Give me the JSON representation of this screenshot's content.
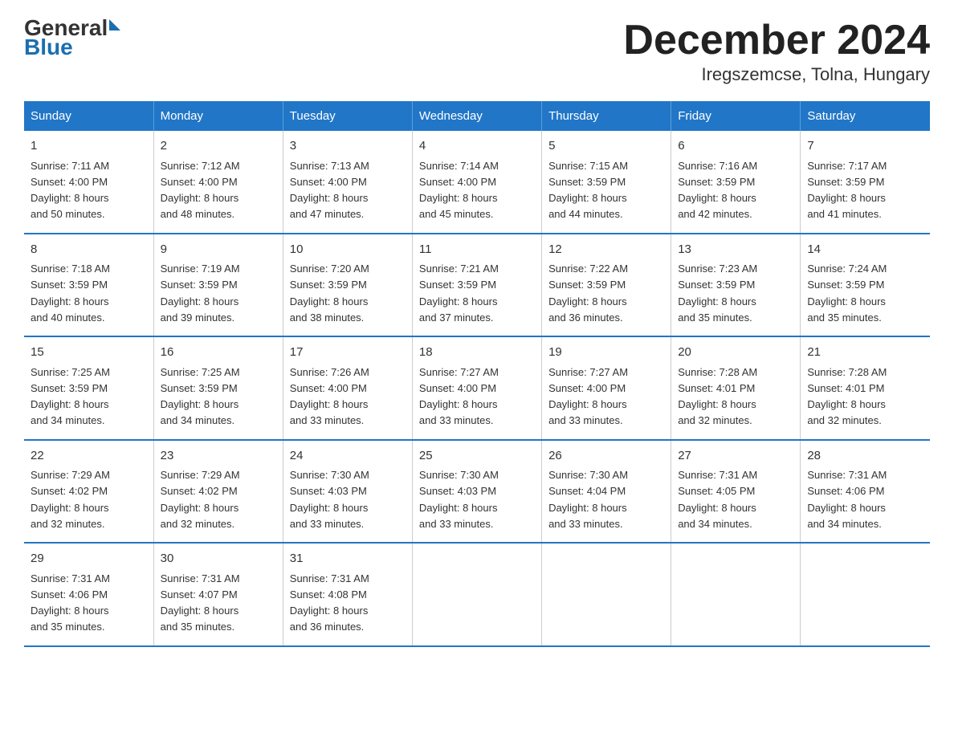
{
  "logo": {
    "text_general": "General",
    "text_blue": "Blue"
  },
  "title": "December 2024",
  "subtitle": "Iregszemcse, Tolna, Hungary",
  "days_of_week": [
    "Sunday",
    "Monday",
    "Tuesday",
    "Wednesday",
    "Thursday",
    "Friday",
    "Saturday"
  ],
  "weeks": [
    [
      {
        "day": "1",
        "sunrise": "7:11 AM",
        "sunset": "4:00 PM",
        "daylight": "8 hours and 50 minutes."
      },
      {
        "day": "2",
        "sunrise": "7:12 AM",
        "sunset": "4:00 PM",
        "daylight": "8 hours and 48 minutes."
      },
      {
        "day": "3",
        "sunrise": "7:13 AM",
        "sunset": "4:00 PM",
        "daylight": "8 hours and 47 minutes."
      },
      {
        "day": "4",
        "sunrise": "7:14 AM",
        "sunset": "4:00 PM",
        "daylight": "8 hours and 45 minutes."
      },
      {
        "day": "5",
        "sunrise": "7:15 AM",
        "sunset": "3:59 PM",
        "daylight": "8 hours and 44 minutes."
      },
      {
        "day": "6",
        "sunrise": "7:16 AM",
        "sunset": "3:59 PM",
        "daylight": "8 hours and 42 minutes."
      },
      {
        "day": "7",
        "sunrise": "7:17 AM",
        "sunset": "3:59 PM",
        "daylight": "8 hours and 41 minutes."
      }
    ],
    [
      {
        "day": "8",
        "sunrise": "7:18 AM",
        "sunset": "3:59 PM",
        "daylight": "8 hours and 40 minutes."
      },
      {
        "day": "9",
        "sunrise": "7:19 AM",
        "sunset": "3:59 PM",
        "daylight": "8 hours and 39 minutes."
      },
      {
        "day": "10",
        "sunrise": "7:20 AM",
        "sunset": "3:59 PM",
        "daylight": "8 hours and 38 minutes."
      },
      {
        "day": "11",
        "sunrise": "7:21 AM",
        "sunset": "3:59 PM",
        "daylight": "8 hours and 37 minutes."
      },
      {
        "day": "12",
        "sunrise": "7:22 AM",
        "sunset": "3:59 PM",
        "daylight": "8 hours and 36 minutes."
      },
      {
        "day": "13",
        "sunrise": "7:23 AM",
        "sunset": "3:59 PM",
        "daylight": "8 hours and 35 minutes."
      },
      {
        "day": "14",
        "sunrise": "7:24 AM",
        "sunset": "3:59 PM",
        "daylight": "8 hours and 35 minutes."
      }
    ],
    [
      {
        "day": "15",
        "sunrise": "7:25 AM",
        "sunset": "3:59 PM",
        "daylight": "8 hours and 34 minutes."
      },
      {
        "day": "16",
        "sunrise": "7:25 AM",
        "sunset": "3:59 PM",
        "daylight": "8 hours and 34 minutes."
      },
      {
        "day": "17",
        "sunrise": "7:26 AM",
        "sunset": "4:00 PM",
        "daylight": "8 hours and 33 minutes."
      },
      {
        "day": "18",
        "sunrise": "7:27 AM",
        "sunset": "4:00 PM",
        "daylight": "8 hours and 33 minutes."
      },
      {
        "day": "19",
        "sunrise": "7:27 AM",
        "sunset": "4:00 PM",
        "daylight": "8 hours and 33 minutes."
      },
      {
        "day": "20",
        "sunrise": "7:28 AM",
        "sunset": "4:01 PM",
        "daylight": "8 hours and 32 minutes."
      },
      {
        "day": "21",
        "sunrise": "7:28 AM",
        "sunset": "4:01 PM",
        "daylight": "8 hours and 32 minutes."
      }
    ],
    [
      {
        "day": "22",
        "sunrise": "7:29 AM",
        "sunset": "4:02 PM",
        "daylight": "8 hours and 32 minutes."
      },
      {
        "day": "23",
        "sunrise": "7:29 AM",
        "sunset": "4:02 PM",
        "daylight": "8 hours and 32 minutes."
      },
      {
        "day": "24",
        "sunrise": "7:30 AM",
        "sunset": "4:03 PM",
        "daylight": "8 hours and 33 minutes."
      },
      {
        "day": "25",
        "sunrise": "7:30 AM",
        "sunset": "4:03 PM",
        "daylight": "8 hours and 33 minutes."
      },
      {
        "day": "26",
        "sunrise": "7:30 AM",
        "sunset": "4:04 PM",
        "daylight": "8 hours and 33 minutes."
      },
      {
        "day": "27",
        "sunrise": "7:31 AM",
        "sunset": "4:05 PM",
        "daylight": "8 hours and 34 minutes."
      },
      {
        "day": "28",
        "sunrise": "7:31 AM",
        "sunset": "4:06 PM",
        "daylight": "8 hours and 34 minutes."
      }
    ],
    [
      {
        "day": "29",
        "sunrise": "7:31 AM",
        "sunset": "4:06 PM",
        "daylight": "8 hours and 35 minutes."
      },
      {
        "day": "30",
        "sunrise": "7:31 AM",
        "sunset": "4:07 PM",
        "daylight": "8 hours and 35 minutes."
      },
      {
        "day": "31",
        "sunrise": "7:31 AM",
        "sunset": "4:08 PM",
        "daylight": "8 hours and 36 minutes."
      },
      null,
      null,
      null,
      null
    ]
  ],
  "labels": {
    "sunrise": "Sunrise:",
    "sunset": "Sunset:",
    "daylight": "Daylight:"
  }
}
